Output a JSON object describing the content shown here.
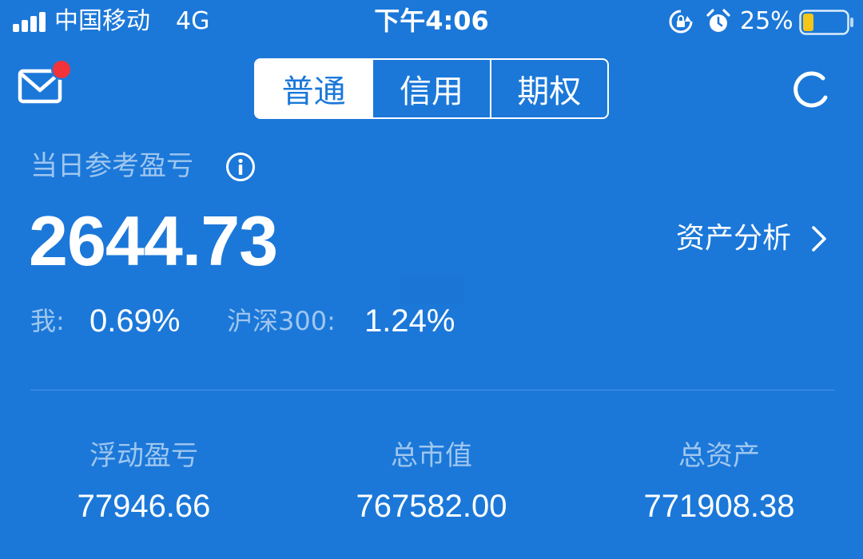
{
  "status_bar": {
    "carrier": "中国移动",
    "network": "4G",
    "time": "下午4:06",
    "battery_percent": "25%",
    "battery_level": 0.25,
    "icons": [
      "signal-icon",
      "rotation-lock-icon",
      "alarm-icon",
      "battery-icon"
    ]
  },
  "header": {
    "mail_icon": "mail-icon",
    "has_unread": true,
    "tabs": [
      {
        "label": "普通",
        "active": true
      },
      {
        "label": "信用",
        "active": false
      },
      {
        "label": "期权",
        "active": false
      }
    ],
    "refresh_icon": "refresh-icon"
  },
  "pnl": {
    "title": "当日参考盈亏",
    "value": "2644.73",
    "analysis_label": "资产分析",
    "compare": {
      "me_label": "我:",
      "me_value": "0.69%",
      "index_label": "沪深300:",
      "index_value": "1.24%"
    }
  },
  "stats": [
    {
      "label": "浮动盈亏",
      "value": "77946.66"
    },
    {
      "label": "总市值",
      "value": "767582.00"
    },
    {
      "label": "总资产",
      "value": "771908.38"
    }
  ],
  "colors": {
    "background": "#1b78d9",
    "text": "#ffffff",
    "muted_text": "#9fc6ef",
    "badge": "#f2333a",
    "battery_fill": "#f5c518"
  }
}
